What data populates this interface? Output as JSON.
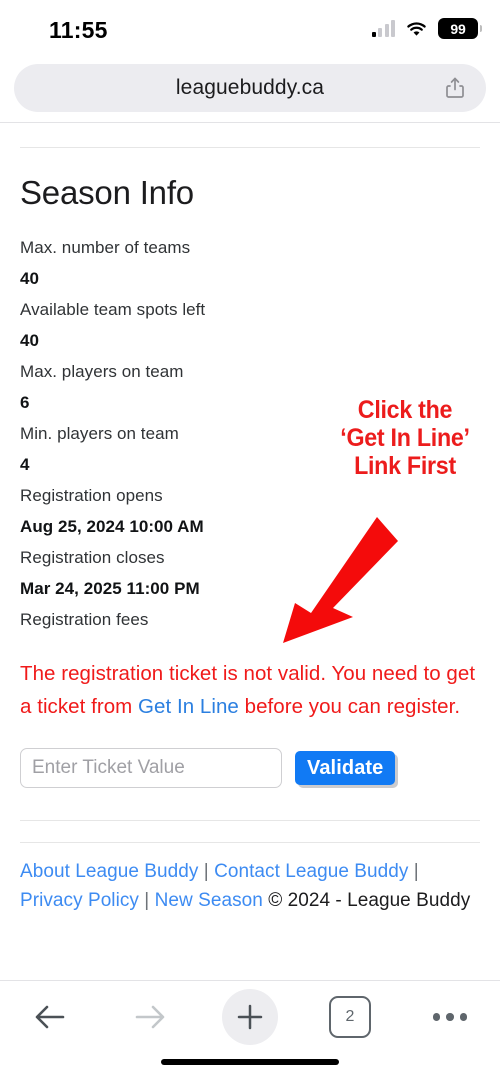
{
  "status_bar": {
    "time": "11:55",
    "battery_percent": "99",
    "signal_icon": "cellular-signal-icon",
    "wifi_icon": "wifi-icon",
    "battery_icon": "battery-icon"
  },
  "browser": {
    "url": "leaguebuddy.ca",
    "share_icon": "share-icon",
    "toolbar": {
      "back_icon": "back-arrow-icon",
      "forward_icon": "forward-arrow-icon",
      "new_tab_icon": "plus-icon",
      "tab_count": "2",
      "more_icon": "more-options-icon"
    }
  },
  "page": {
    "title": "Season Info",
    "info": [
      {
        "label": "Max. number of teams",
        "value": "40"
      },
      {
        "label": "Available team spots left",
        "value": "40"
      },
      {
        "label": "Max. players on team",
        "value": "6"
      },
      {
        "label": "Min. players on team",
        "value": "4"
      },
      {
        "label": "Registration opens",
        "value": "Aug 25, 2024 10:00 AM"
      },
      {
        "label": "Registration closes",
        "value": "Mar 24, 2025 11:00 PM"
      },
      {
        "label": "Registration fees",
        "value": ""
      }
    ],
    "error": {
      "text_before": "The registration ticket is not valid. You need to get a ticket from ",
      "link_text": "Get In Line",
      "text_after": " before you can register.",
      "color": "#f01a1a",
      "link_color": "#2b7fe0"
    },
    "form": {
      "ticket_placeholder": "Enter Ticket Value",
      "ticket_value": "",
      "validate_label": "Validate",
      "validate_color": "#117af4"
    },
    "footer": {
      "link_1": "About League Buddy",
      "link_2": "Contact League Buddy",
      "link_3": "Privacy Policy",
      "link_4": "New Season",
      "separator": "|",
      "copyright": "© 2024 - League Buddy",
      "link_color": "#3d8bf2"
    }
  },
  "annotation": {
    "line_1": "Click the",
    "line_2": "‘Get In Line’",
    "line_3": "Link First",
    "color": "#ec1c1c",
    "arrow_icon": "red-arrow-icon"
  }
}
